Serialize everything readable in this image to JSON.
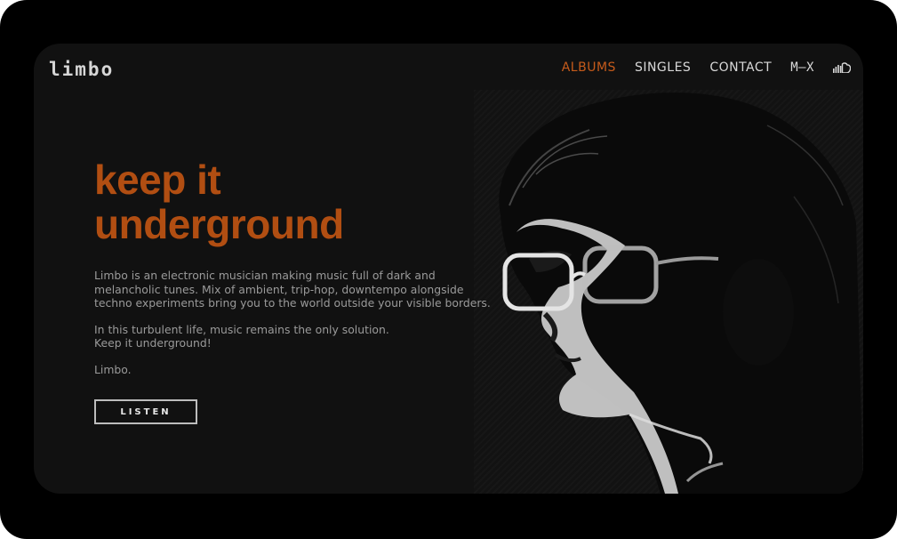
{
  "brand": {
    "logo_text": "limbo"
  },
  "nav": {
    "items": [
      {
        "label": "ALBUMS",
        "active": true
      },
      {
        "label": "SINGLES",
        "active": false
      },
      {
        "label": "CONTACT",
        "active": false
      },
      {
        "label": "M—X",
        "active": false
      }
    ],
    "social_icon": "soundcloud-icon"
  },
  "hero": {
    "title_line1": "keep it",
    "title_line2": "underground",
    "paragraph1_lines": [
      "Limbo is an electronic musician making music full of dark and",
      "melancholic tunes. Mix of ambient, trip-hop, downtempo alongside",
      "techno experiments bring you to the world outside your visible borders."
    ],
    "paragraph2_lines": [
      "In this turbulent life, music remains the only solution.",
      "Keep it underground!"
    ],
    "signature": "Limbo.",
    "cta_label": "LISTEN"
  },
  "colors": {
    "accent": "#c65b1b",
    "title": "#b14e12",
    "background": "#111111",
    "frame": "#000000"
  }
}
